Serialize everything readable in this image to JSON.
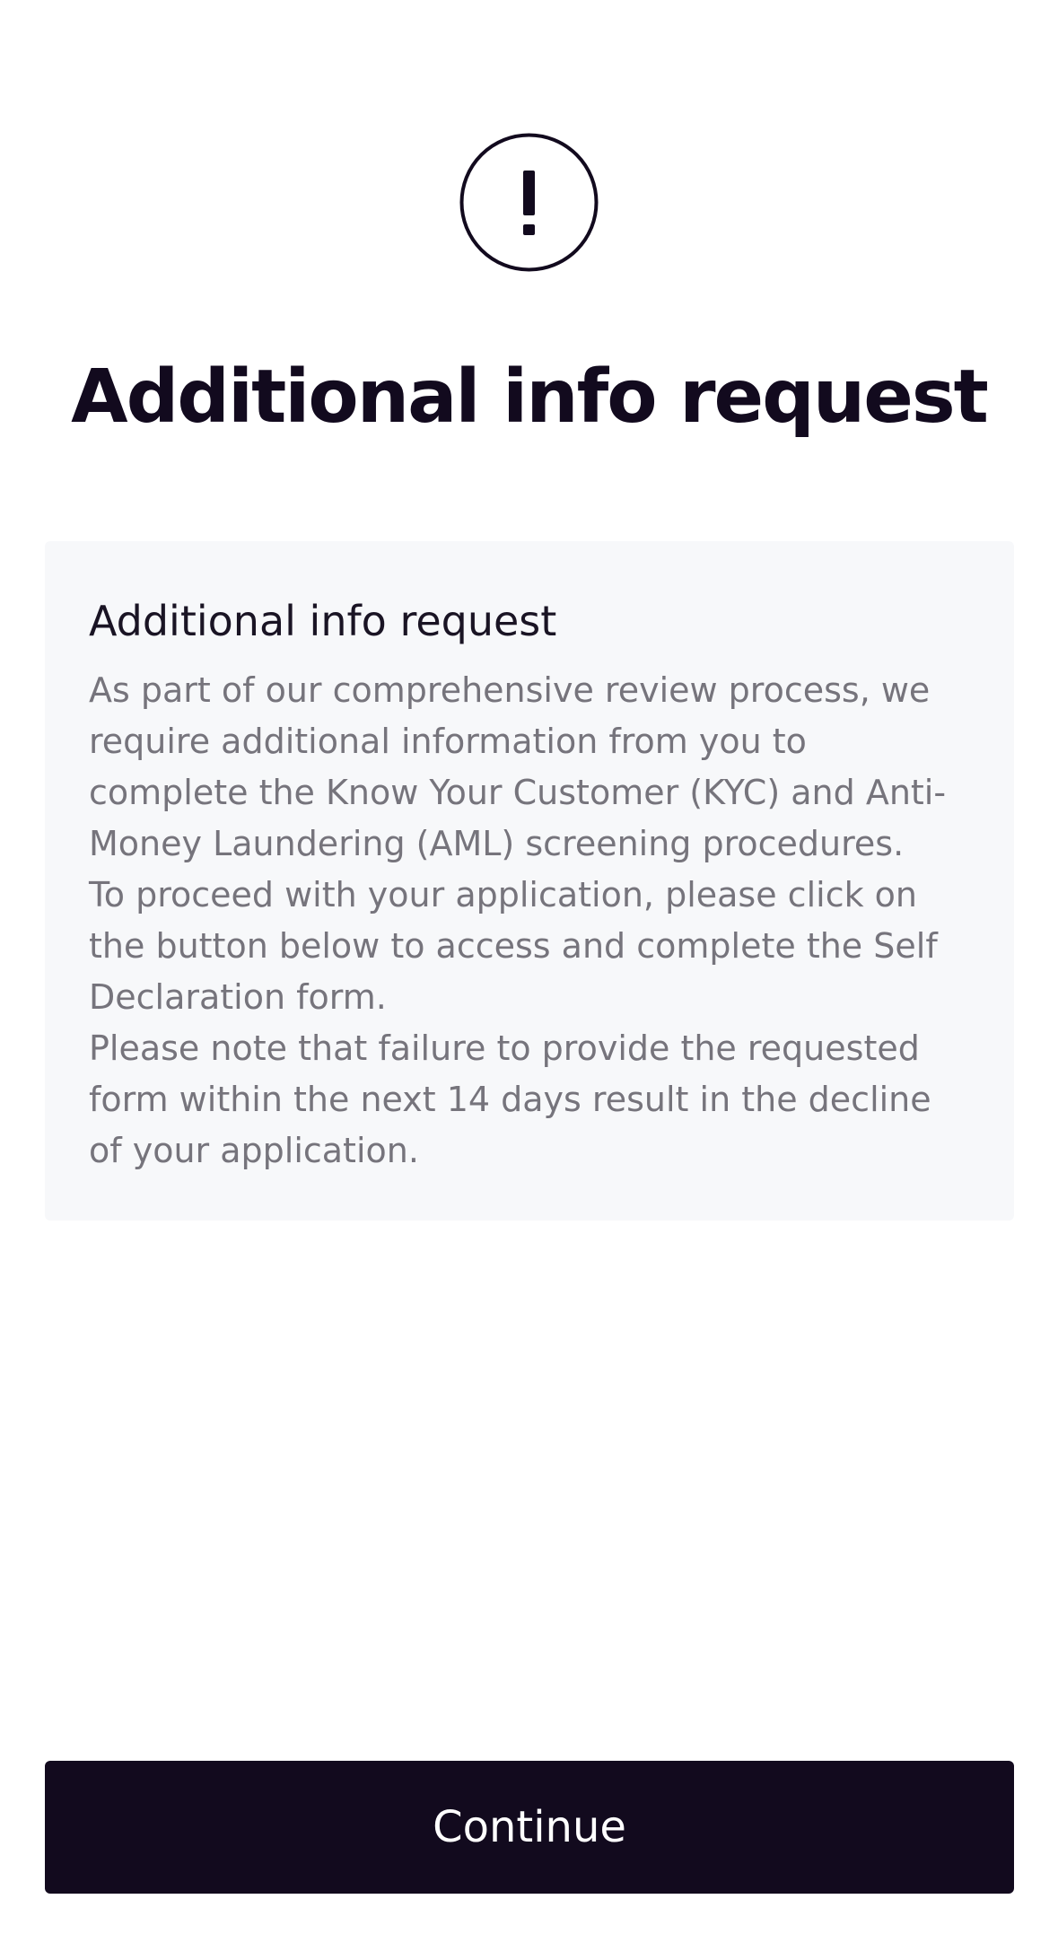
{
  "header": {
    "icon": "exclamation-circle-icon",
    "title": "Additional info request"
  },
  "card": {
    "title": "Additional info request",
    "paragraphs": [
      "As part of our comprehensive review process, we require additional information from you to complete the Know Your Customer (KYC) and Anti-Money Laundering (AML) screening procedures.",
      "To proceed with your application, please click on the button below to access and complete the Self Declaration form.",
      "Please note that failure to provide the requested form within the next 14 days result in the decline of your application."
    ]
  },
  "footer": {
    "continue_label": "Continue"
  },
  "colors": {
    "primary": "#120a1e",
    "card_background": "#f7f8fa",
    "body_text": "#76747c"
  }
}
